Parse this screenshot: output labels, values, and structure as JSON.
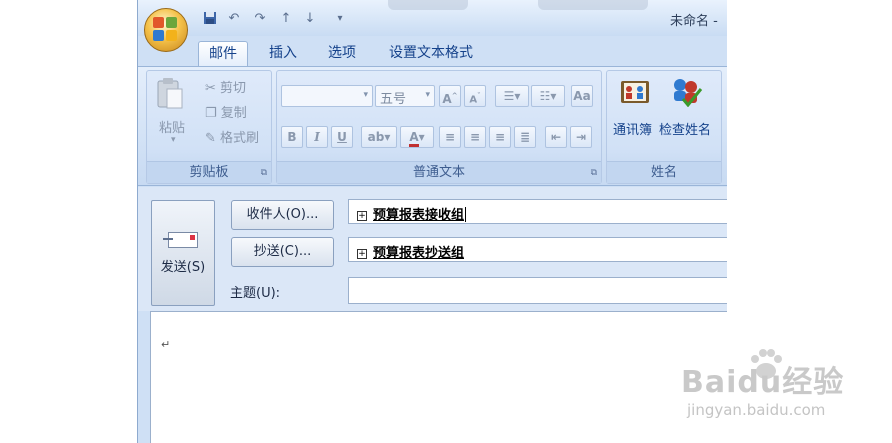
{
  "window": {
    "title": "未命名 -"
  },
  "tabs": [
    "邮件",
    "插入",
    "选项",
    "设置文本格式"
  ],
  "ribbon": {
    "clipboard": {
      "paste": "粘贴",
      "cut": "剪切",
      "copy": "复制",
      "format_painter": "格式刷",
      "group_label": "剪贴板"
    },
    "basic_text": {
      "font_size": "五号",
      "group_label": "普通文本"
    },
    "names": {
      "address_book": "通讯簿",
      "check_names": "检查姓名",
      "group_label": "姓名"
    }
  },
  "header": {
    "send": "发送(S)",
    "to_button": "收件人(O)...",
    "cc_button": "抄送(C)...",
    "subject_label": "主题(U):",
    "to_value": "预算报表接收组",
    "cc_value": "预算报表抄送组",
    "subject_value": ""
  },
  "body": {
    "paragraph_mark": "↵"
  },
  "watermark": {
    "brand": "Baidu经验",
    "url": "jingyan.baidu.com"
  },
  "colors": {
    "ribbon_bg": "#dbe7f7",
    "text": "#15428b",
    "accent": "#f5c24a"
  }
}
